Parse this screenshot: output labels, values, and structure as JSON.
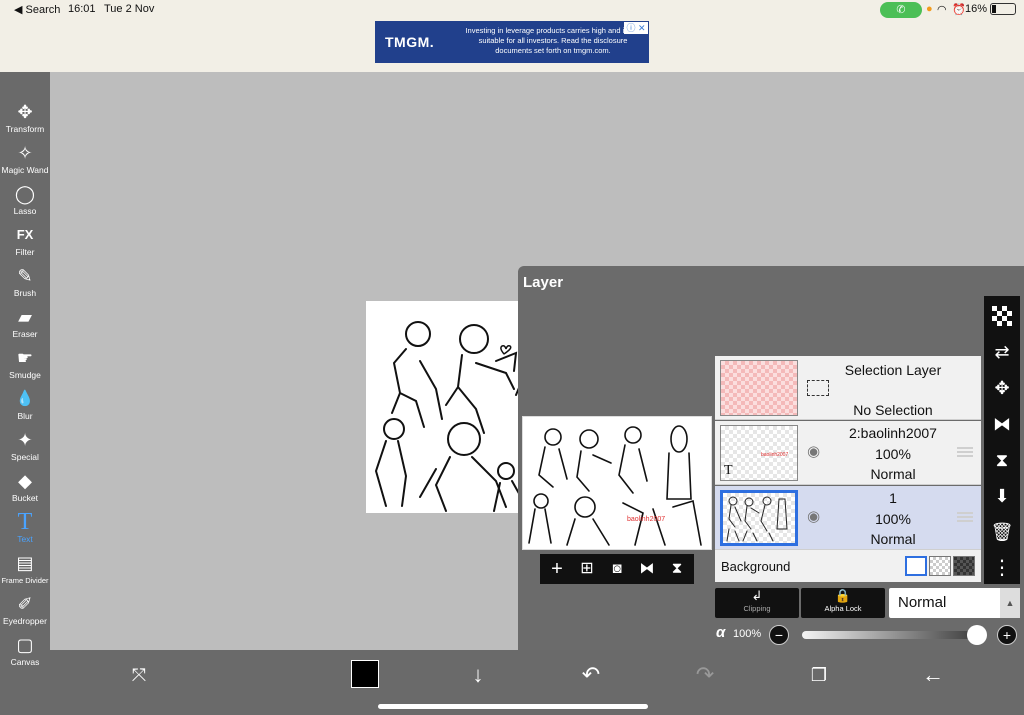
{
  "status_bar": {
    "back_app": "◀ Search",
    "time": "16:01",
    "date": "Tue 2 Nov",
    "battery": "16%"
  },
  "ad": {
    "brand": "TMGM.",
    "text": "Investing in leverage products carries high and is not suitable for all investors. Read the disclosure documents set forth on tmgm.com."
  },
  "tools": [
    {
      "label": "Transform",
      "icon": "✥"
    },
    {
      "label": "Magic Wand",
      "icon": "✧"
    },
    {
      "label": "Lasso",
      "icon": "◯"
    },
    {
      "label": "Filter",
      "icon": "FX"
    },
    {
      "label": "Brush",
      "icon": "✎"
    },
    {
      "label": "Eraser",
      "icon": "▰"
    },
    {
      "label": "Smudge",
      "icon": "☛"
    },
    {
      "label": "Blur",
      "icon": "💧"
    },
    {
      "label": "Special",
      "icon": "✦"
    },
    {
      "label": "Bucket",
      "icon": "◆"
    },
    {
      "label": "Text",
      "icon": "T"
    },
    {
      "label": "Frame Divider",
      "icon": "▤"
    },
    {
      "label": "Eyedropper",
      "icon": "✐"
    },
    {
      "label": "Canvas",
      "icon": "▢"
    }
  ],
  "canvas_sketch": {
    "signature": "baolinh2007"
  },
  "layer_panel": {
    "title": "Layer",
    "layers": [
      {
        "name": "Selection Layer",
        "status": "No Selection"
      },
      {
        "name": "2:baolinh2007",
        "opacity": "100%",
        "blend": "Normal",
        "type_icon": "T"
      },
      {
        "name": "1",
        "opacity": "100%",
        "blend": "Normal",
        "selected": true
      }
    ],
    "background_label": "Background",
    "clipping_label": "Clipping",
    "alpha_lock_label": "Alpha Lock",
    "blend_mode": "Normal",
    "alpha_symbol": "α",
    "alpha_value": "100%",
    "alpha_fraction": 1.0
  },
  "accent_color": "#2e6fe0"
}
